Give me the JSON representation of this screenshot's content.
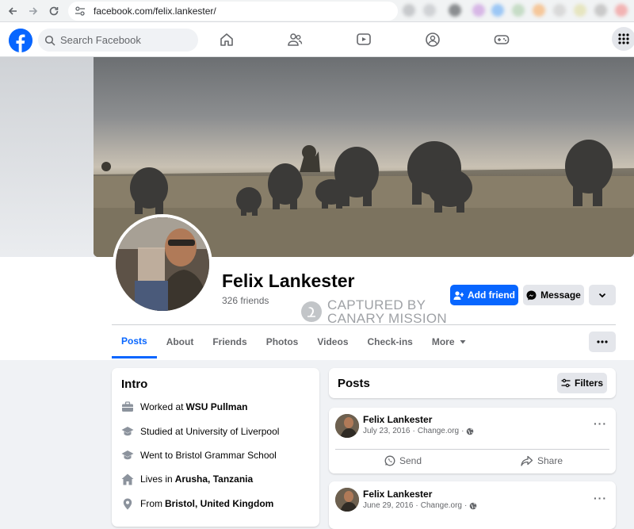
{
  "browser": {
    "url": "facebook.com/felix.lankester/"
  },
  "header": {
    "search_placeholder": "Search Facebook"
  },
  "profile": {
    "name": "Felix Lankester",
    "friends": "326 friends",
    "add_friend_label": "Add friend",
    "message_label": "Message"
  },
  "watermark": {
    "line1": "CAPTURED BY",
    "line2": "CANARY MISSION"
  },
  "tabs": [
    {
      "label": "Posts"
    },
    {
      "label": "About"
    },
    {
      "label": "Friends"
    },
    {
      "label": "Photos"
    },
    {
      "label": "Videos"
    },
    {
      "label": "Check-ins"
    },
    {
      "label": "More"
    }
  ],
  "intro": {
    "title": "Intro",
    "items": [
      {
        "prefix": "Worked at ",
        "bold": "WSU Pullman",
        "icon": "briefcase-icon"
      },
      {
        "prefix": "Studied at University of Liverpool",
        "bold": "",
        "icon": "graduation-cap-icon"
      },
      {
        "prefix": "Went to Bristol Grammar School",
        "bold": "",
        "icon": "graduation-cap-icon"
      },
      {
        "prefix": "Lives in ",
        "bold": "Arusha, Tanzania",
        "icon": "home-icon"
      },
      {
        "prefix": "From ",
        "bold": "Bristol, United Kingdom",
        "icon": "location-pin-icon"
      }
    ]
  },
  "posts": {
    "title": "Posts",
    "filters_label": "Filters",
    "items": [
      {
        "author": "Felix Lankester",
        "date": "July 23, 2016",
        "source": "Change.org",
        "send_label": "Send",
        "share_label": "Share"
      },
      {
        "author": "Felix Lankester",
        "date": "June 29, 2016",
        "source": "Change.org"
      }
    ]
  },
  "colors": {
    "brand": "#0866ff",
    "background": "#f0f2f5",
    "secondary_text": "#65676b"
  }
}
